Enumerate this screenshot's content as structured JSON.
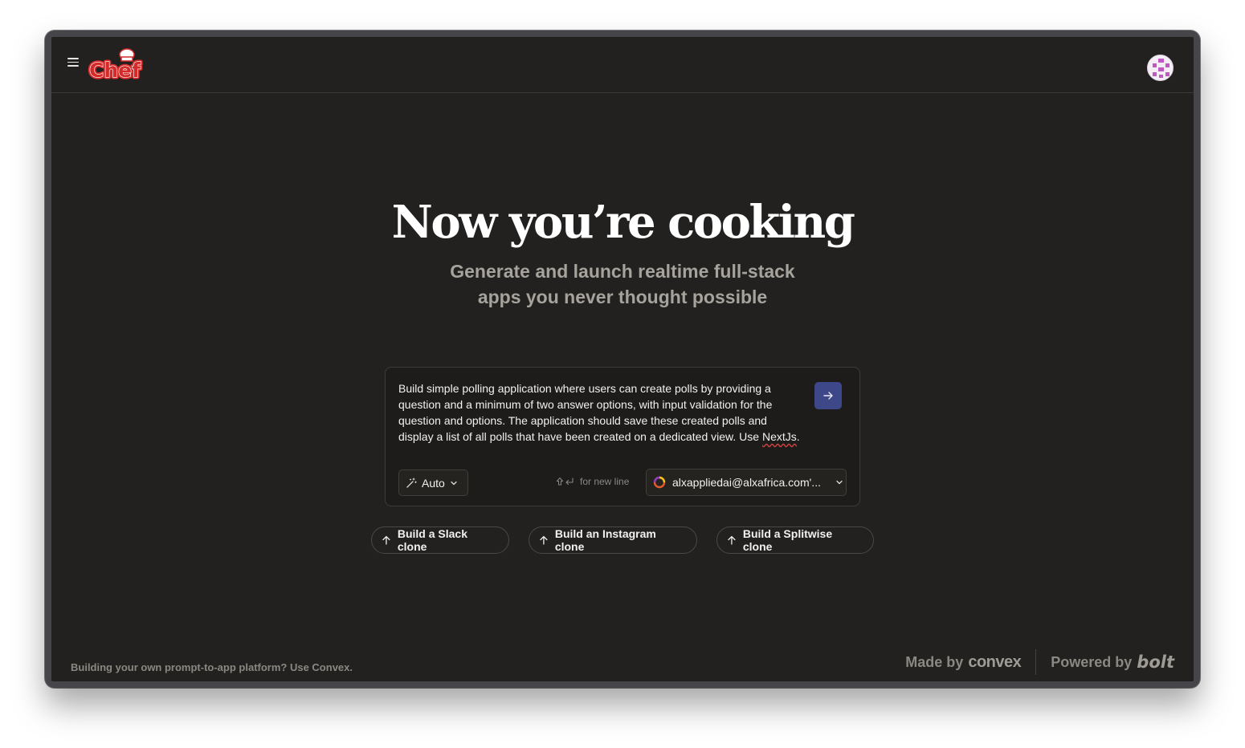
{
  "app": {
    "logo_text": "Chef"
  },
  "hero": {
    "title": "Now you’re cooking",
    "subtitle": "Generate and launch realtime full-stack\napps you never thought possible"
  },
  "prompt": {
    "text_main": "Build simple polling application where users can create polls by providing a question and a minimum of two answer options, with input validation for the question and options. The application should save these created polls and display a list of all polls that have been created on a dedicated view. Use ",
    "text_underlined": "NextJs",
    "text_end": ".",
    "model_label": "Auto",
    "newline_hint": "for new line",
    "team_label": "alxappliedai@alxafrica.com'...",
    "accent_color": "#3e4889"
  },
  "suggestions": [
    {
      "label": "Build a Slack clone"
    },
    {
      "label": "Build an Instagram clone"
    },
    {
      "label": "Build a Splitwise clone"
    }
  ],
  "footer": {
    "left": "Building your own prompt-to-app platform? Use Convex.",
    "made_by": "Made by",
    "made_by_brand": "convex",
    "powered_by": "Powered by",
    "powered_by_brand": "bolt"
  }
}
